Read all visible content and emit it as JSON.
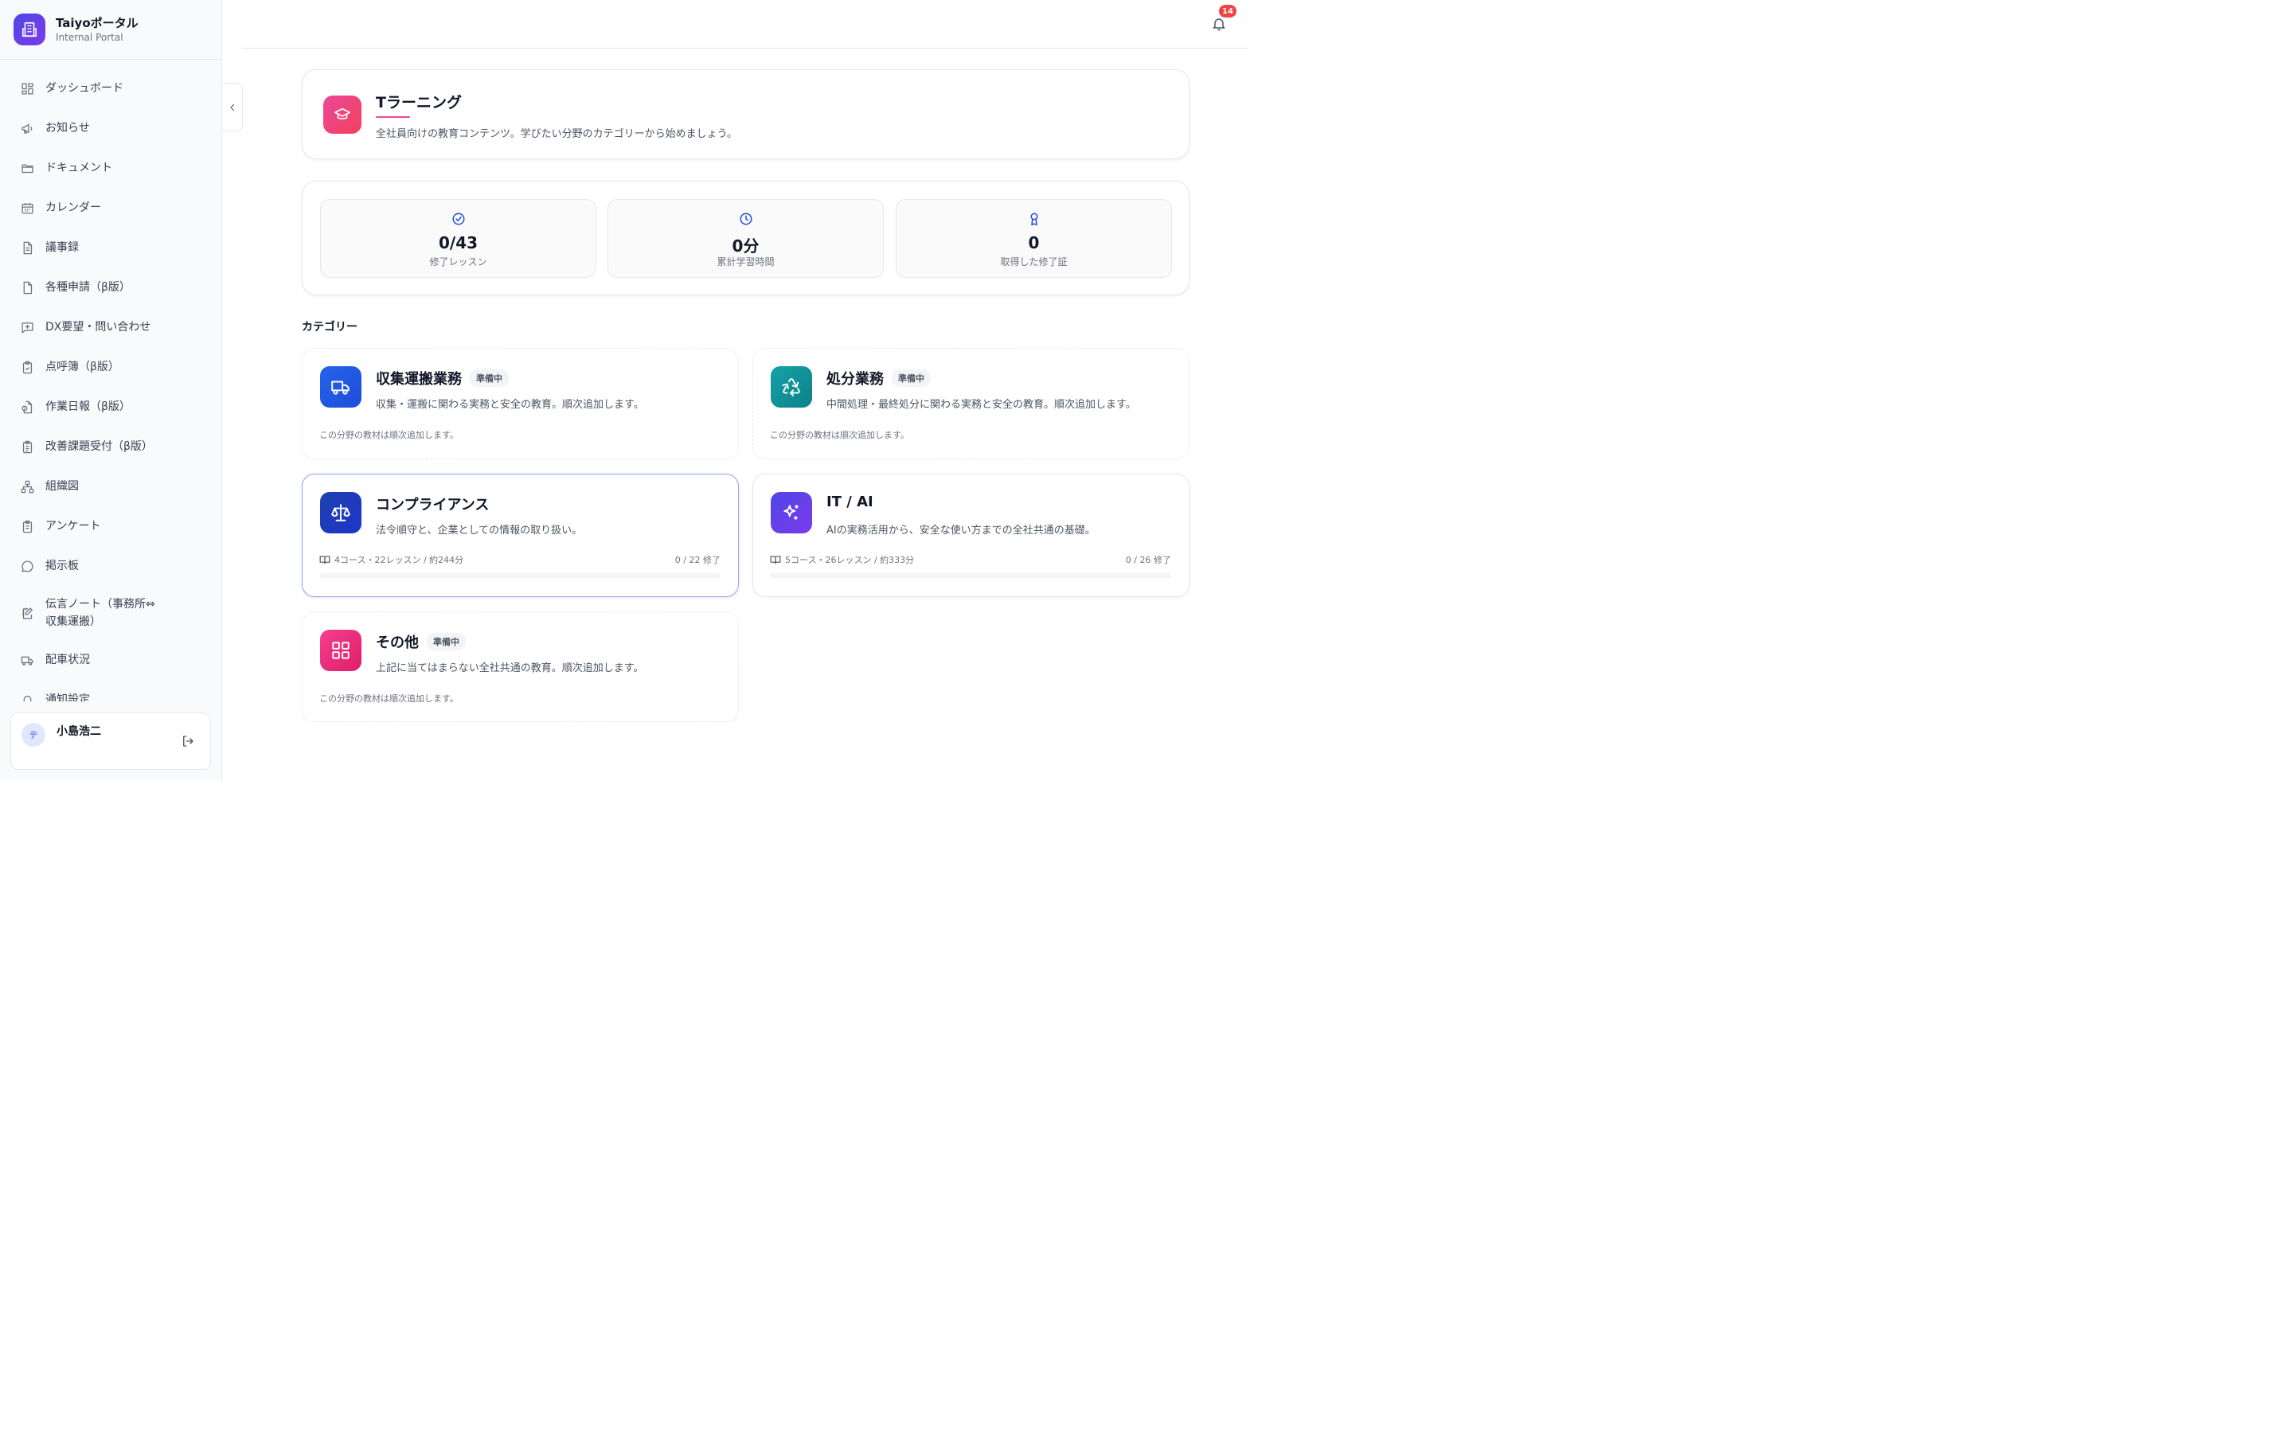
{
  "brand": {
    "title": "Taiyoポータル",
    "subtitle": "Internal Portal"
  },
  "sidebar": {
    "items": [
      {
        "label": "ダッシュボード",
        "icon": "dashboard-icon"
      },
      {
        "label": "お知らせ",
        "icon": "megaphone-icon"
      },
      {
        "label": "ドキュメント",
        "icon": "folder-icon"
      },
      {
        "label": "カレンダー",
        "icon": "calendar-icon"
      },
      {
        "label": "議事録",
        "icon": "document-icon"
      },
      {
        "label": "各種申請（β版）",
        "icon": "file-icon"
      },
      {
        "label": "DX要望・問い合わせ",
        "icon": "message-plus-icon"
      },
      {
        "label": "点呼簿（β版）",
        "icon": "clipboard-check-icon"
      },
      {
        "label": "作業日報（β版）",
        "icon": "file-clock-icon"
      },
      {
        "label": "改善課題受付（β版）",
        "icon": "clipboard-list-icon"
      },
      {
        "label": "組織図",
        "icon": "org-chart-icon"
      },
      {
        "label": "アンケート",
        "icon": "clipboard-icon"
      },
      {
        "label": "掲示板",
        "icon": "chat-bubble-icon"
      },
      {
        "label": "伝言ノート（事務所⇔収集運搬）",
        "line1": "伝言ノート（事務所⇔",
        "line2": "収集運搬）",
        "icon": "note-edit-icon"
      },
      {
        "label": "配車状況",
        "icon": "truck-icon"
      },
      {
        "label": "通知設定",
        "icon": "bell-icon"
      }
    ]
  },
  "user": {
    "avatar": "テ",
    "name": "小島浩二"
  },
  "header": {
    "notification_count": "14"
  },
  "hero": {
    "title": "Tラーニング",
    "description": "全社員向けの教育コンテンツ。学びたい分野のカテゴリーから始めましょう。"
  },
  "stats": [
    {
      "value": "0/43",
      "label": "修了レッスン",
      "icon": "check-circle-icon"
    },
    {
      "value": "0分",
      "label": "累計学習時間",
      "icon": "clock-icon"
    },
    {
      "value": "0",
      "label": "取得した修了証",
      "icon": "award-icon"
    }
  ],
  "section_title": "カテゴリー",
  "categories": [
    {
      "title": "収集運搬業務",
      "badge": "準備中",
      "description": "収集・運搬に関わる実務と安全の教育。順次追加します。",
      "note": "この分野の教材は順次追加します。",
      "icon": "truck-icon",
      "color": "#1d5fe0"
    },
    {
      "title": "処分業務",
      "badge": "準備中",
      "description": "中間処理・最終処分に関わる実務と安全の教育。順次追加します。",
      "note": "この分野の教材は順次追加します。",
      "icon": "recycle-icon",
      "color": "#0f8f96"
    },
    {
      "title": "コンプライアンス",
      "description": "法令順守と、企業としての情報の取り扱い。",
      "meta": "4コース・22レッスン / 約244分",
      "progress_text": "0 / 22 修了",
      "progress": 0,
      "icon": "scale-icon",
      "color": "#1e3fbf"
    },
    {
      "title": "IT / AI",
      "description": "AIの実務活用から、安全な使い方までの全社共通の基礎。",
      "meta": "5コース・26レッスン / 約333分",
      "progress_text": "0 / 26 修了",
      "progress": 0,
      "icon": "sparkles-icon",
      "color": "#5b3fe0"
    },
    {
      "title": "その他",
      "badge": "準備中",
      "description": "上記に当てはまらない全社共通の教育。順次追加します。",
      "note": "この分野の教材は順次追加します。",
      "icon": "grid-icon",
      "color": "#ec2f7f"
    }
  ]
}
